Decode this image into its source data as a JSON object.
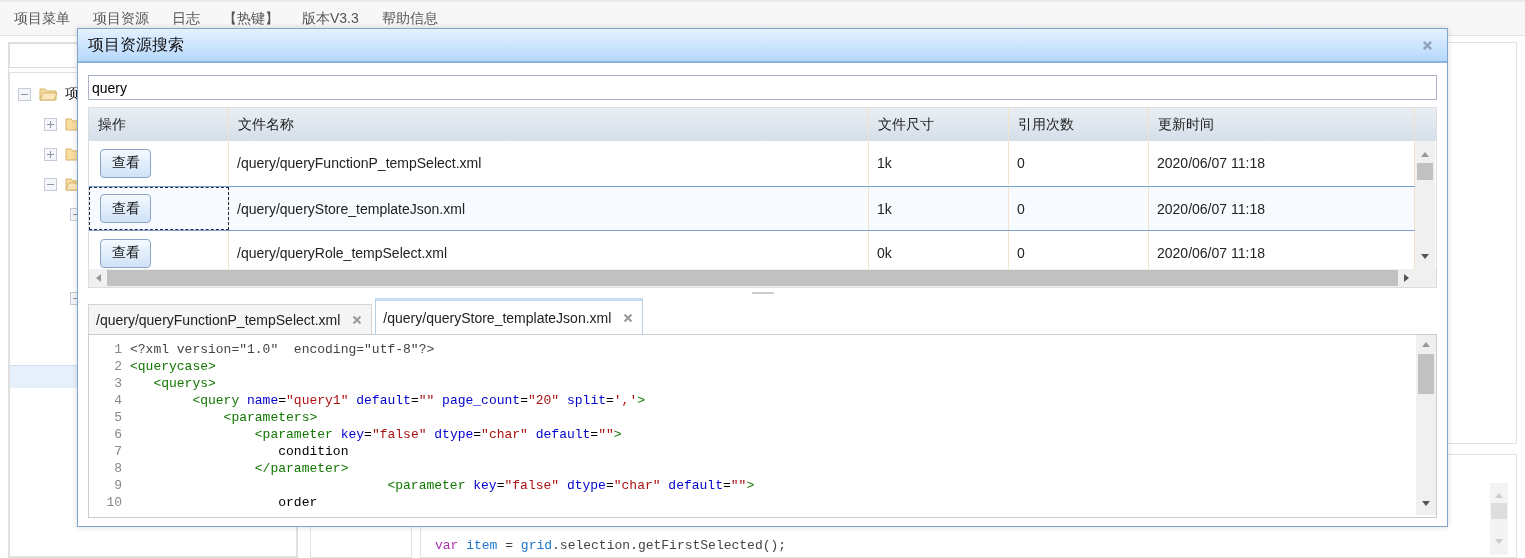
{
  "menu": [
    "项目菜单",
    "项目资源",
    "日志",
    "【热键】",
    "版本V3.3",
    "帮助信息"
  ],
  "background": {
    "tree": [
      {
        "label": "项",
        "expanded": true,
        "children": [
          {
            "expanded": false
          },
          {
            "expanded": false
          },
          {
            "expanded": true,
            "children": [
              {
                "expanded": true
              },
              {
                "expanded": true
              }
            ]
          }
        ]
      }
    ],
    "code_line": [
      {
        "kind": "keyword",
        "text": "var "
      },
      {
        "kind": "variable",
        "text": "item"
      },
      {
        "kind": "plain",
        "text": " = "
      },
      {
        "kind": "variable",
        "text": "grid"
      },
      {
        "kind": "plain",
        "text": ".selection.getFirstSelected();"
      }
    ]
  },
  "dialog": {
    "title": "项目资源搜索",
    "search": {
      "value": "query"
    },
    "table": {
      "columns": [
        "操作",
        "文件名称",
        "文件尺寸",
        "引用次数",
        "更新时间"
      ],
      "rows": [
        {
          "action": "查看",
          "file": "/query/queryFunctionP_tempSelect.xml",
          "size": "1k",
          "refs": "0",
          "updated": "2020/06/07 11:18",
          "selected": false
        },
        {
          "action": "查看",
          "file": "/query/queryStore_templateJson.xml",
          "size": "1k",
          "refs": "0",
          "updated": "2020/06/07 11:18",
          "selected": true
        },
        {
          "action": "查看",
          "file": "/query/queryRole_tempSelect.xml",
          "size": "0k",
          "refs": "0",
          "updated": "2020/06/07 11:18",
          "selected": false
        }
      ]
    },
    "tabs": [
      {
        "label": "/query/queryFunctionP_tempSelect.xml",
        "selected": false
      },
      {
        "label": "/query/queryStore_templateJson.xml",
        "selected": true
      }
    ],
    "editor": {
      "lines": [
        {
          "num": "1",
          "tokens": [
            {
              "kind": "pi",
              "text": "<?xml version=\"1.0\"  encoding=\"utf-8\"?>"
            }
          ]
        },
        {
          "num": "2",
          "tokens": [
            {
              "kind": "tag",
              "text": "<querycase>"
            }
          ]
        },
        {
          "num": "3",
          "tokens": [
            {
              "kind": "tag",
              "text": "   <querys>"
            }
          ]
        },
        {
          "num": "4",
          "tokens": [
            {
              "kind": "tag",
              "text": "        <query"
            },
            {
              "kind": "attr",
              "text": " name"
            },
            {
              "kind": "text",
              "text": "="
            },
            {
              "kind": "str",
              "text": "\"query1\""
            },
            {
              "kind": "attr",
              "text": " default"
            },
            {
              "kind": "text",
              "text": "="
            },
            {
              "kind": "str",
              "text": "\"\""
            },
            {
              "kind": "attr",
              "text": " page_count"
            },
            {
              "kind": "text",
              "text": "="
            },
            {
              "kind": "str",
              "text": "\"20\""
            },
            {
              "kind": "attr",
              "text": " split"
            },
            {
              "kind": "text",
              "text": "="
            },
            {
              "kind": "str",
              "text": "','"
            },
            {
              "kind": "tag",
              "text": ">"
            }
          ]
        },
        {
          "num": "5",
          "tokens": [
            {
              "kind": "tag",
              "text": "            <parameters>"
            }
          ]
        },
        {
          "num": "6",
          "tokens": [
            {
              "kind": "tag",
              "text": "                <parameter"
            },
            {
              "kind": "attr",
              "text": " key"
            },
            {
              "kind": "text",
              "text": "="
            },
            {
              "kind": "str",
              "text": "\"false\""
            },
            {
              "kind": "attr",
              "text": " dtype"
            },
            {
              "kind": "text",
              "text": "="
            },
            {
              "kind": "str",
              "text": "\"char\""
            },
            {
              "kind": "attr",
              "text": " default"
            },
            {
              "kind": "text",
              "text": "="
            },
            {
              "kind": "str",
              "text": "\"\""
            },
            {
              "kind": "tag",
              "text": ">"
            }
          ]
        },
        {
          "num": "7",
          "tokens": [
            {
              "kind": "text",
              "text": "                   condition"
            }
          ]
        },
        {
          "num": "8",
          "tokens": [
            {
              "kind": "tag",
              "text": "                </parameter>"
            }
          ]
        },
        {
          "num": "9",
          "tokens": [
            {
              "kind": "tag",
              "text": "                                 <parameter"
            },
            {
              "kind": "attr",
              "text": " key"
            },
            {
              "kind": "text",
              "text": "="
            },
            {
              "kind": "str",
              "text": "\"false\""
            },
            {
              "kind": "attr",
              "text": " dtype"
            },
            {
              "kind": "text",
              "text": "="
            },
            {
              "kind": "str",
              "text": "\"char\""
            },
            {
              "kind": "attr",
              "text": " default"
            },
            {
              "kind": "text",
              "text": "="
            },
            {
              "kind": "str",
              "text": "\"\""
            },
            {
              "kind": "tag",
              "text": ">"
            }
          ]
        },
        {
          "num": "10",
          "tokens": [
            {
              "kind": "text",
              "text": "                   order"
            }
          ]
        }
      ]
    }
  }
}
